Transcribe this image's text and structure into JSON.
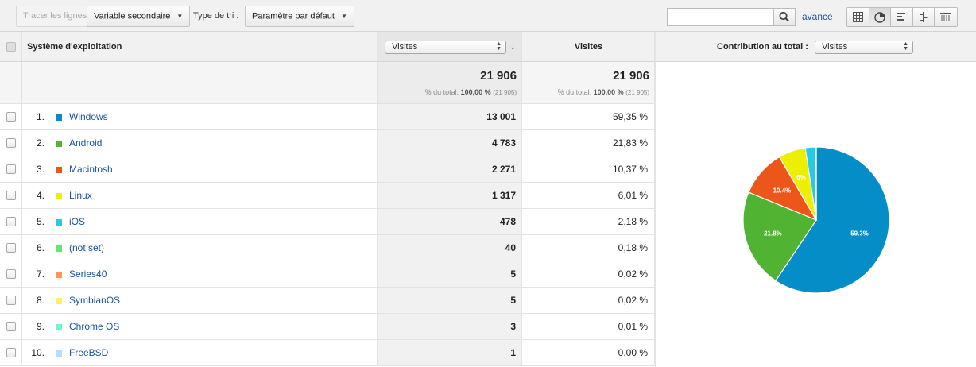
{
  "toolbar": {
    "plot_rows_label": "Tracer les lignes",
    "secondary_dimension_label": "Variable secondaire",
    "sort_type_label": "Type de tri :",
    "sort_default_label": "Paramètre par défaut",
    "search_placeholder": "",
    "advanced_label": "avancé",
    "view_buttons": [
      "table-view-icon",
      "pie-view-icon",
      "performance-view-icon",
      "comparison-view-icon",
      "pivot-view-icon"
    ],
    "active_view": "pie-view-icon"
  },
  "table": {
    "dimension_header": "Système d'exploitation",
    "metric1_select": "Visites",
    "metric2_header": "Visites",
    "totals": {
      "m1_value": "21 906",
      "m1_pct_label": "% du total:",
      "m1_pct": "100,00 %",
      "m1_abs": "(21 905)",
      "m2_value": "21 906",
      "m2_pct_label": "% du total:",
      "m2_pct": "100,00 %",
      "m2_abs": "(21 905)"
    },
    "rows": [
      {
        "index": "1.",
        "name": "Windows",
        "color": "#058dc7",
        "visits": "13 001",
        "share": "59,35 %"
      },
      {
        "index": "2.",
        "name": "Android",
        "color": "#50b432",
        "visits": "4 783",
        "share": "21,83 %"
      },
      {
        "index": "3.",
        "name": "Macintosh",
        "color": "#ed561b",
        "visits": "2 271",
        "share": "10,37 %"
      },
      {
        "index": "4.",
        "name": "Linux",
        "color": "#edef00",
        "visits": "1 317",
        "share": "6,01 %"
      },
      {
        "index": "5.",
        "name": "iOS",
        "color": "#24cbe5",
        "visits": "478",
        "share": "2,18 %"
      },
      {
        "index": "6.",
        "name": "(not set)",
        "color": "#64e572",
        "visits": "40",
        "share": "0,18 %"
      },
      {
        "index": "7.",
        "name": "Series40",
        "color": "#ff9655",
        "visits": "5",
        "share": "0,02 %"
      },
      {
        "index": "8.",
        "name": "SymbianOS",
        "color": "#fff263",
        "visits": "5",
        "share": "0,02 %"
      },
      {
        "index": "9.",
        "name": "Chrome OS",
        "color": "#6af9c4",
        "visits": "3",
        "share": "0,01 %"
      },
      {
        "index": "10.",
        "name": "FreeBSD",
        "color": "#b2deff",
        "visits": "1",
        "share": "0,00 %"
      }
    ]
  },
  "pie": {
    "contribution_label": "Contribution au total :",
    "metric_select": "Visites"
  },
  "chart_data": {
    "type": "pie",
    "title": "",
    "categories": [
      "Windows",
      "Android",
      "Macintosh",
      "Linux",
      "iOS",
      "(not set)",
      "Series40",
      "SymbianOS",
      "Chrome OS",
      "FreeBSD"
    ],
    "values": [
      59.35,
      21.83,
      10.37,
      6.01,
      2.18,
      0.18,
      0.02,
      0.02,
      0.01,
      0.0
    ],
    "colors": [
      "#058dc7",
      "#50b432",
      "#ed561b",
      "#edef00",
      "#24cbe5",
      "#64e572",
      "#ff9655",
      "#fff263",
      "#6af9c4",
      "#b2deff"
    ],
    "slice_labels": [
      "59.3%",
      "21.8%",
      "10.4%",
      "6%",
      "",
      "",
      "",
      "",
      "",
      ""
    ]
  }
}
